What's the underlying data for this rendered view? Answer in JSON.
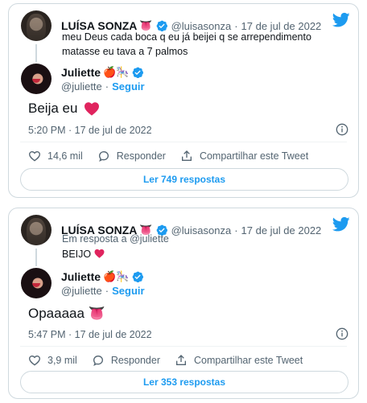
{
  "tweets": [
    {
      "author": {
        "name": "LUÍSA SONZA",
        "emoji": "👅",
        "handle": "@luisasonza",
        "date": "17 de jul de 2022"
      },
      "quoted_text": "meu Deus cada boca q eu já beijei q se arrependimento matasse eu tava a 7 palmos",
      "reply_to": "",
      "reply_author": {
        "name": "Juliette",
        "emoji": "🍎🎠",
        "handle": "@juliette",
        "follow": "Seguir"
      },
      "text": "Beija eu",
      "time": "5:20 PM · 17 de jul de 2022",
      "likes": "14,6 mil",
      "reply_label": "Responder",
      "share_label": "Compartilhar este Tweet",
      "read_label": "Ler 749 respostas"
    },
    {
      "author": {
        "name": "LUÍSA SONZA",
        "emoji": "👅",
        "handle": "@luisasonza",
        "date": "17 de jul de 2022"
      },
      "reply_to": "Em resposta a @juliette",
      "quoted_text": "BEIJO",
      "reply_author": {
        "name": "Juliette",
        "emoji": "🍎🎠",
        "handle": "@juliette",
        "follow": "Seguir"
      },
      "text": "Opaaaaa 👅",
      "time": "5:47 PM · 17 de jul de 2022",
      "likes": "3,9 mil",
      "reply_label": "Responder",
      "share_label": "Compartilhar este Tweet",
      "read_label": "Ler 353 respostas"
    }
  ],
  "colors": {
    "accent": "#1d9bf0",
    "heart": "#e0245e",
    "muted": "#536471",
    "border": "#cfd9de"
  },
  "separator": "·"
}
